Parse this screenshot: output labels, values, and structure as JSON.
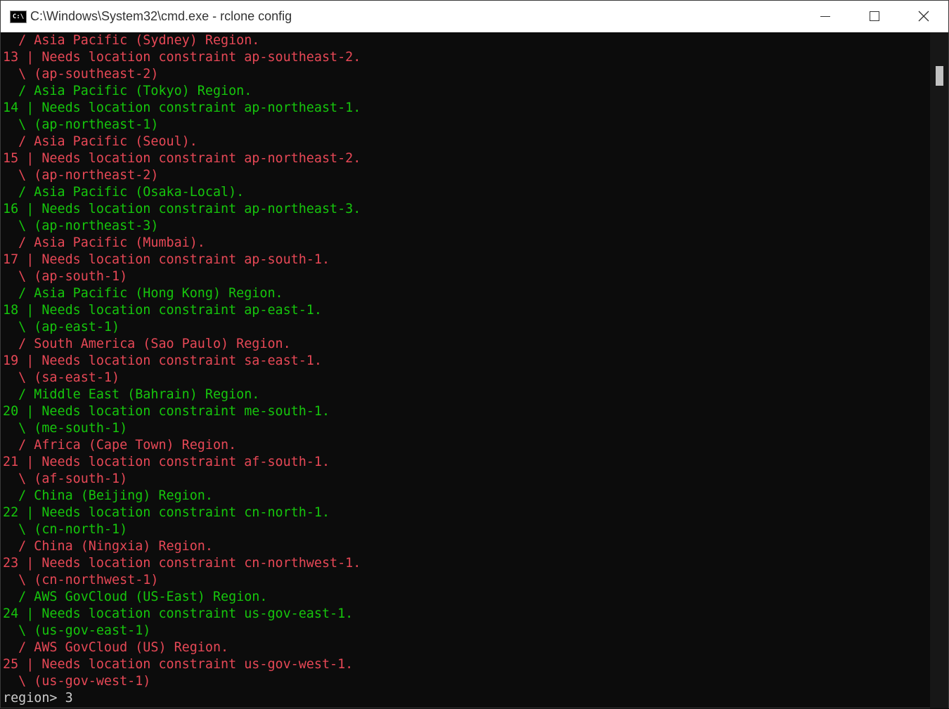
{
  "window": {
    "title": "C:\\Windows\\System32\\cmd.exe - rclone  config",
    "icon": "console-icon",
    "icon_text": "C:\\"
  },
  "console": {
    "lines": [
      {
        "text": "  / Asia Pacific (Sydney) Region.",
        "color": "red"
      },
      {
        "text": "13 | Needs location constraint ap-southeast-2.",
        "color": "red"
      },
      {
        "text": "  \\ (ap-southeast-2)",
        "color": "red"
      },
      {
        "text": "  / Asia Pacific (Tokyo) Region.",
        "color": "green"
      },
      {
        "text": "14 | Needs location constraint ap-northeast-1.",
        "color": "green"
      },
      {
        "text": "  \\ (ap-northeast-1)",
        "color": "green"
      },
      {
        "text": "  / Asia Pacific (Seoul).",
        "color": "red"
      },
      {
        "text": "15 | Needs location constraint ap-northeast-2.",
        "color": "red"
      },
      {
        "text": "  \\ (ap-northeast-2)",
        "color": "red"
      },
      {
        "text": "  / Asia Pacific (Osaka-Local).",
        "color": "green"
      },
      {
        "text": "16 | Needs location constraint ap-northeast-3.",
        "color": "green"
      },
      {
        "text": "  \\ (ap-northeast-3)",
        "color": "green"
      },
      {
        "text": "  / Asia Pacific (Mumbai).",
        "color": "red"
      },
      {
        "text": "17 | Needs location constraint ap-south-1.",
        "color": "red"
      },
      {
        "text": "  \\ (ap-south-1)",
        "color": "red"
      },
      {
        "text": "  / Asia Pacific (Hong Kong) Region.",
        "color": "green"
      },
      {
        "text": "18 | Needs location constraint ap-east-1.",
        "color": "green"
      },
      {
        "text": "  \\ (ap-east-1)",
        "color": "green"
      },
      {
        "text": "  / South America (Sao Paulo) Region.",
        "color": "red"
      },
      {
        "text": "19 | Needs location constraint sa-east-1.",
        "color": "red"
      },
      {
        "text": "  \\ (sa-east-1)",
        "color": "red"
      },
      {
        "text": "  / Middle East (Bahrain) Region.",
        "color": "green"
      },
      {
        "text": "20 | Needs location constraint me-south-1.",
        "color": "green"
      },
      {
        "text": "  \\ (me-south-1)",
        "color": "green"
      },
      {
        "text": "  / Africa (Cape Town) Region.",
        "color": "red"
      },
      {
        "text": "21 | Needs location constraint af-south-1.",
        "color": "red"
      },
      {
        "text": "  \\ (af-south-1)",
        "color": "red"
      },
      {
        "text": "  / China (Beijing) Region.",
        "color": "green"
      },
      {
        "text": "22 | Needs location constraint cn-north-1.",
        "color": "green"
      },
      {
        "text": "  \\ (cn-north-1)",
        "color": "green"
      },
      {
        "text": "  / China (Ningxia) Region.",
        "color": "red"
      },
      {
        "text": "23 | Needs location constraint cn-northwest-1.",
        "color": "red"
      },
      {
        "text": "  \\ (cn-northwest-1)",
        "color": "red"
      },
      {
        "text": "  / AWS GovCloud (US-East) Region.",
        "color": "green"
      },
      {
        "text": "24 | Needs location constraint us-gov-east-1.",
        "color": "green"
      },
      {
        "text": "  \\ (us-gov-east-1)",
        "color": "green"
      },
      {
        "text": "  / AWS GovCloud (US) Region.",
        "color": "red"
      },
      {
        "text": "25 | Needs location constraint us-gov-west-1.",
        "color": "red"
      },
      {
        "text": "  \\ (us-gov-west-1)",
        "color": "red"
      }
    ],
    "prompt": "region> 3"
  },
  "colors": {
    "red": "#e74856",
    "green": "#16c60c",
    "background": "#0c0c0c",
    "foreground": "#cccccc"
  }
}
